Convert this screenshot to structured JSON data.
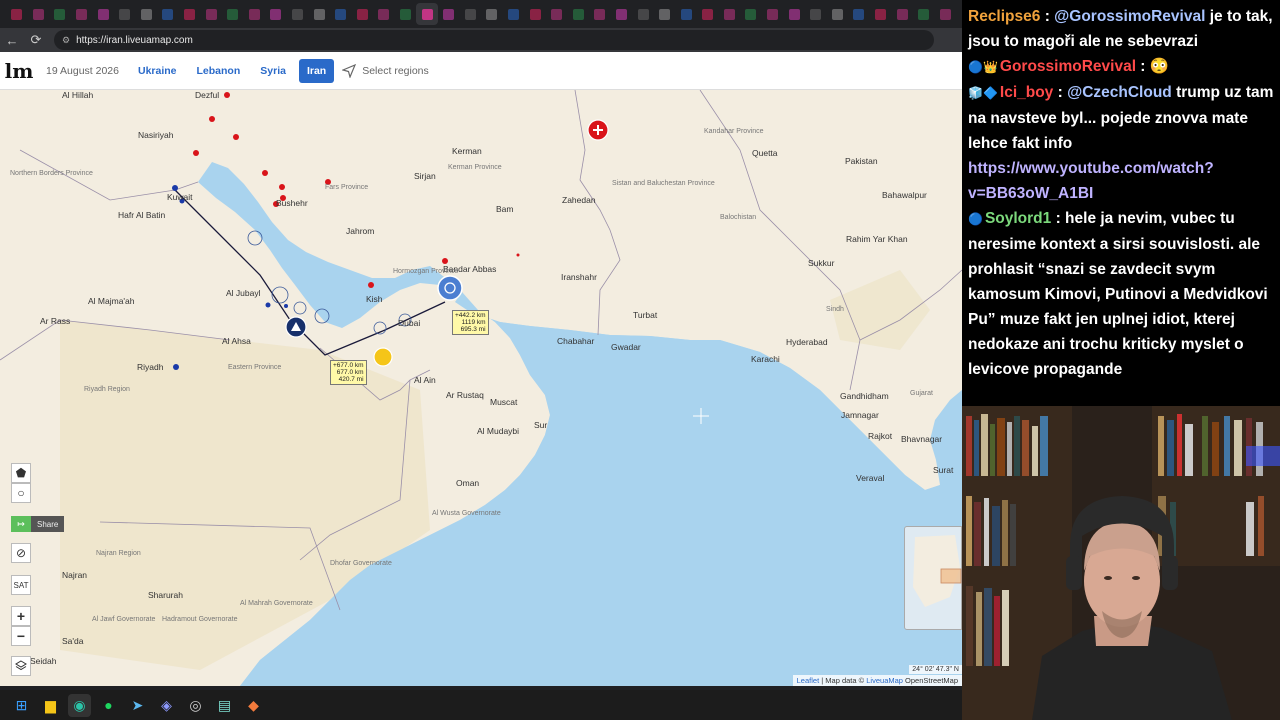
{
  "browser": {
    "url": "https://iran.liveuamap.com",
    "tab_count": 44,
    "active_tab_index": 19
  },
  "site": {
    "logo": "lm",
    "date": "19 August 2026",
    "regions": [
      {
        "label": "Ukraine",
        "active": false
      },
      {
        "label": "Lebanon",
        "active": false
      },
      {
        "label": "Syria",
        "active": false
      },
      {
        "label": "Iran",
        "active": true
      }
    ],
    "select_regions": "Select regions"
  },
  "map": {
    "labels": [
      {
        "text": "Al Hillah",
        "kind": "city"
      },
      {
        "text": "Nasiriyah",
        "kind": "city"
      },
      {
        "text": "Dezful",
        "kind": "city"
      },
      {
        "text": "Kuwait",
        "kind": "city"
      },
      {
        "text": "Hafr Al Batin",
        "kind": "city"
      },
      {
        "text": "Northern Borders Province",
        "kind": "prov"
      },
      {
        "text": "Al Majma'ah",
        "kind": "city"
      },
      {
        "text": "Ar Rass",
        "kind": "city"
      },
      {
        "text": "Riyadh",
        "kind": "city"
      },
      {
        "text": "Al Jubayl",
        "kind": "city"
      },
      {
        "text": "Al Ahsa",
        "kind": "city"
      },
      {
        "text": "Kerman",
        "kind": "city"
      },
      {
        "text": "Bam",
        "kind": "city"
      },
      {
        "text": "Jahrom",
        "kind": "city"
      },
      {
        "text": "Kish",
        "kind": "city"
      },
      {
        "text": "Bandar Abbas",
        "kind": "city"
      },
      {
        "text": "Sirjan",
        "kind": "city"
      },
      {
        "text": "Zahedan",
        "kind": "city"
      },
      {
        "text": "Iranshahr",
        "kind": "city"
      },
      {
        "text": "Turbat",
        "kind": "city"
      },
      {
        "text": "Quetta",
        "kind": "city"
      },
      {
        "text": "Chabahar",
        "kind": "city"
      },
      {
        "text": "Gwadar",
        "kind": "city"
      },
      {
        "text": "Karachi",
        "kind": "city"
      },
      {
        "text": "Hyderabad",
        "kind": "city"
      },
      {
        "text": "Sukkur",
        "kind": "city"
      },
      {
        "text": "Bahawalpur",
        "kind": "city"
      },
      {
        "text": "Rahim Yar Khan",
        "kind": "city"
      },
      {
        "text": "Pakistan",
        "kind": "city"
      },
      {
        "text": "Jamnagar",
        "kind": "city"
      },
      {
        "text": "Rajkot",
        "kind": "city"
      },
      {
        "text": "Bhavnagar",
        "kind": "city"
      },
      {
        "text": "Surat",
        "kind": "city"
      },
      {
        "text": "Veraval",
        "kind": "city"
      },
      {
        "text": "Gandhidham",
        "kind": "city"
      },
      {
        "text": "Dubai",
        "kind": "city"
      },
      {
        "text": "Al Ain",
        "kind": "city"
      },
      {
        "text": "Ar Rustaq",
        "kind": "city"
      },
      {
        "text": "Muscat",
        "kind": "city"
      },
      {
        "text": "Al Mudaybi",
        "kind": "city"
      },
      {
        "text": "Sur",
        "kind": "city"
      },
      {
        "text": "Oman",
        "kind": "city"
      },
      {
        "text": "Al Wusta Governorate",
        "kind": "prov"
      },
      {
        "text": "Dhofar Governorate",
        "kind": "prov"
      },
      {
        "text": "Najran",
        "kind": "city"
      },
      {
        "text": "Sharurah",
        "kind": "city"
      },
      {
        "text": "Sa'da",
        "kind": "city"
      },
      {
        "text": "Al Mahrah Governorate",
        "kind": "prov"
      },
      {
        "text": "Hadramout Governorate",
        "kind": "prov"
      },
      {
        "text": "Al Jawf Governorate",
        "kind": "prov"
      },
      {
        "text": "Najran Region",
        "kind": "prov"
      },
      {
        "text": "Eastern Province",
        "kind": "prov"
      },
      {
        "text": "Riyadh Region",
        "kind": "prov"
      },
      {
        "text": "Seidah",
        "kind": "city"
      },
      {
        "text": "Bushehr",
        "kind": "city"
      },
      {
        "text": "Fars Province",
        "kind": "prov"
      },
      {
        "text": "Kerman Province",
        "kind": "prov"
      },
      {
        "text": "Sistan and Baluchestan Province",
        "kind": "prov"
      },
      {
        "text": "Hormozgan Province",
        "kind": "prov"
      },
      {
        "text": "Kandahar Province",
        "kind": "prov"
      },
      {
        "text": "Balochistan",
        "kind": "prov"
      },
      {
        "text": "Sindh",
        "kind": "prov"
      },
      {
        "text": "Gujarat",
        "kind": "prov"
      }
    ],
    "distance_badges": [
      {
        "lines": [
          "+442.2 km",
          "1119 km",
          "695.3 mi"
        ]
      },
      {
        "lines": [
          "+677.0 km",
          "677.0 km",
          "420.7 mi"
        ]
      }
    ],
    "controls": {
      "share": "Share",
      "sat": "SAT",
      "zoom_in": "+",
      "zoom_out": "−"
    },
    "attribution": {
      "leaflet": "Leaflet",
      "sep": " | Map data © ",
      "liveuamap": "LiveuaMap",
      "osm": " OpenStreetMap"
    },
    "coords": "24° 02' 47.3\" N"
  },
  "chat": {
    "messages": [
      {
        "user": "Reclipse6",
        "user_color": "#f0a23c",
        "badges": "",
        "mention": "@GorossimoRevival",
        "text": " je to tak, jsou to magoři ale ne sebevrazi"
      },
      {
        "user": "GorossimoRevival",
        "user_color": "#ff4a4a",
        "badges": "🔵👑",
        "mention": "",
        "text": " 😳"
      },
      {
        "user": "Ici_boy",
        "user_color": "#ff4a4a",
        "badges": "🧊🔷",
        "mention": "@CzechCloud",
        "text": " trump uz tam na navsteve byl... pojede znovva mate lehce fakt info "
      },
      {
        "user": "Soylord1",
        "user_color": "#7cd97c",
        "badges": "🔵",
        "mention": "",
        "text": " hele ja nevim, vubec tu neresime kontext a sirsi souvislosti. ale prohlasit “snazi se zavdecit svym kamosum Kimovi, Putinovi a Medvidkovi Pu” muze fakt jen uplnej idiot, kterej nedokaze ani trochu kriticky myslet o levicove propagande"
      }
    ],
    "link": "https://www.youtube.com/watch?v=BB63oW_A1BI"
  },
  "colors": {
    "land": "#f3ede0",
    "sea": "#a9d3ee",
    "desert": "#ede4c8",
    "accent": "#2a6ac9"
  }
}
